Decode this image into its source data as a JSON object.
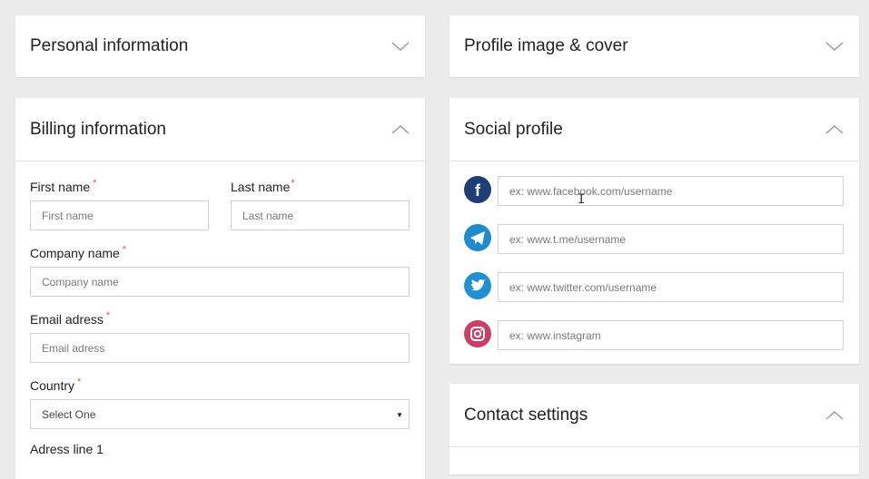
{
  "personal": {
    "title": "Personal information",
    "toggle_icon": "chevron-down-icon"
  },
  "profile_image": {
    "title": "Profile image & cover",
    "toggle_icon": "chevron-down-icon"
  },
  "billing": {
    "title": "Billing information",
    "toggle_icon": "chevron-up-icon",
    "first_name": {
      "label": "First name",
      "required": "*",
      "placeholder": "First name"
    },
    "last_name": {
      "label": "Last name",
      "required": "*",
      "placeholder": "Last name"
    },
    "company": {
      "label": "Company name",
      "required": "*",
      "placeholder": "Company name"
    },
    "email": {
      "label": "Email adress",
      "required": "*",
      "placeholder": "Email adress"
    },
    "country": {
      "label": "Country",
      "required": "*",
      "selected": "Select One",
      "arrow": "▼"
    },
    "address1": {
      "label": "Adress line 1"
    }
  },
  "social": {
    "title": "Social profile",
    "toggle_icon": "chevron-up-icon",
    "facebook": {
      "placeholder": "ex: www.facebook.com/username",
      "color": "#1d3f76",
      "icon": "facebook-icon"
    },
    "telegram": {
      "placeholder": "ex: www.t.me/username",
      "color": "#1f8bcd",
      "icon": "telegram-icon"
    },
    "twitter": {
      "placeholder": "ex: www.twitter.com/username",
      "color": "#2190d3",
      "icon": "twitter-icon"
    },
    "instagram": {
      "placeholder": "ex: www.instagram",
      "color": "#c93f68",
      "icon": "instagram-icon"
    }
  },
  "contact": {
    "title": "Contact settings",
    "toggle_icon": "chevron-up-icon"
  }
}
